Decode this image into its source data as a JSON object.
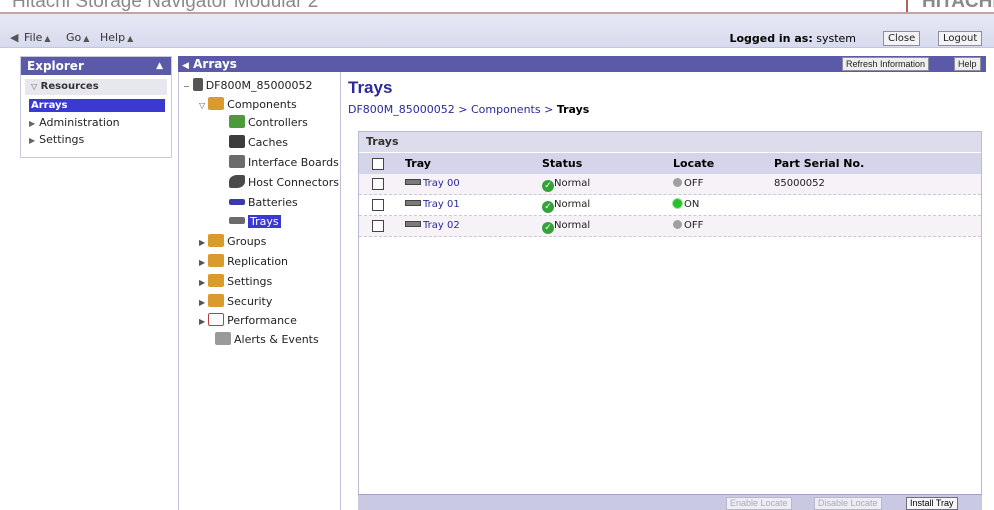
{
  "titlebar": {
    "app_title": "Hitachi Storage Navigator Modular 2",
    "brand_right": "HITACHI"
  },
  "menubar": {
    "menus": [
      {
        "label": "File"
      },
      {
        "label": "Go"
      },
      {
        "label": "Help"
      }
    ],
    "logged_in_label": "Logged in as:",
    "user": "system",
    "close_label": "Close",
    "logout_label": "Logout"
  },
  "explorer": {
    "title": "Explorer",
    "resources_label": "Resources",
    "arrays_label": "Arrays",
    "items": [
      {
        "label": "Administration"
      },
      {
        "label": "Settings"
      }
    ]
  },
  "arrays": {
    "title": "Arrays",
    "refresh_label": "Refresh Information",
    "help_label": "Help"
  },
  "tree": {
    "root": "DF800M_85000052",
    "components": "Components",
    "component_children": [
      "Controllers",
      "Caches",
      "Interface Boards",
      "Host Connectors",
      "Batteries",
      "Trays"
    ],
    "groups": "Groups",
    "replication": "Replication",
    "settings": "Settings",
    "security": "Security",
    "performance": "Performance",
    "alerts": "Alerts & Events"
  },
  "page": {
    "title": "Trays",
    "breadcrumb": {
      "root": "DF800M_85000052",
      "sep": ">",
      "mid": "Components",
      "current": "Trays"
    }
  },
  "grid": {
    "title": "Trays",
    "columns": [
      "Tray",
      "Status",
      "Locate",
      "Part Serial No."
    ],
    "rows": [
      {
        "tray": "Tray 00",
        "status": "Normal",
        "locate": "OFF",
        "serial": "85000052"
      },
      {
        "tray": "Tray 01",
        "status": "Normal",
        "locate": "ON",
        "serial": ""
      },
      {
        "tray": "Tray 02",
        "status": "Normal",
        "locate": "OFF",
        "serial": ""
      }
    ],
    "buttons": {
      "enable_locate": "Enable Locate",
      "disable_locate": "Disable Locate",
      "install_tray": "Install Tray"
    }
  },
  "colors": {
    "accent": "#5a5aa8",
    "link": "#2a2a9a",
    "selected": "#3a3ad0",
    "locate_on": "#26c12d",
    "status_ok": "#35a33a"
  }
}
